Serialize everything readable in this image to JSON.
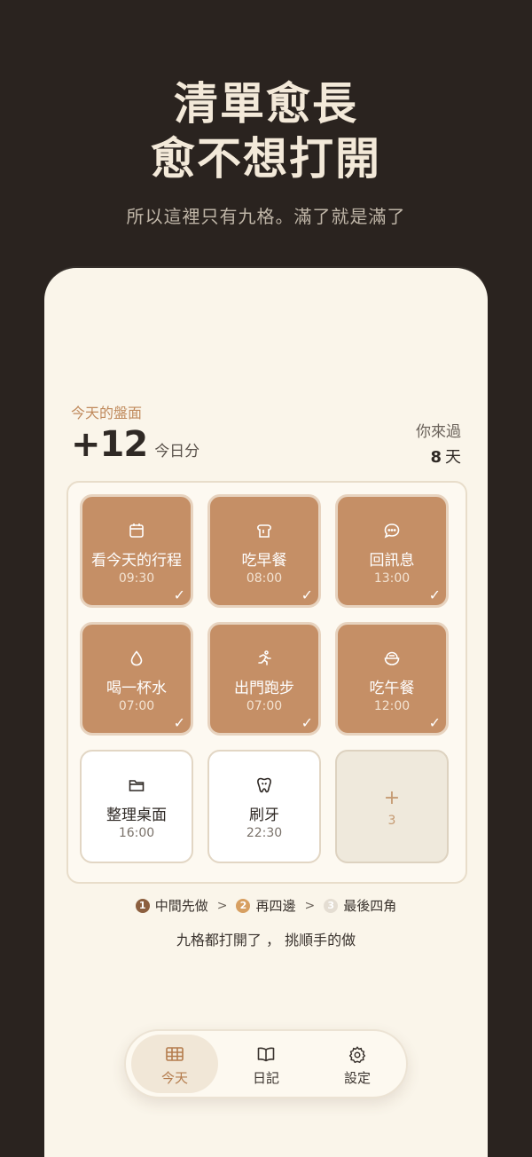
{
  "hero": {
    "title_line1": "清單愈長",
    "title_line2": "愈不想打開",
    "subtitle": "所以這裡只有九格。滿了就是滿了"
  },
  "board": {
    "label": "今天的盤面",
    "score": "+12",
    "score_unit": "今日分",
    "visited_label": "你來過",
    "visited_days": "8",
    "visited_unit": "天"
  },
  "tiles": [
    {
      "name": "看今天的行程",
      "time": "09:30",
      "icon": "calendar-icon",
      "done": true
    },
    {
      "name": "吃早餐",
      "time": "08:00",
      "icon": "toast-icon",
      "done": true
    },
    {
      "name": "回訊息",
      "time": "13:00",
      "icon": "chat-bubble-icon",
      "done": true
    },
    {
      "name": "喝一杯水",
      "time": "07:00",
      "icon": "water-drop-icon",
      "done": true
    },
    {
      "name": "出門跑步",
      "time": "07:00",
      "icon": "runner-icon",
      "done": true
    },
    {
      "name": "吃午餐",
      "time": "12:00",
      "icon": "rice-bowl-icon",
      "done": true
    },
    {
      "name": "整理桌面",
      "time": "16:00",
      "icon": "folder-icon",
      "done": false
    },
    {
      "name": "刷牙",
      "time": "22:30",
      "icon": "tooth-icon",
      "done": false
    }
  ],
  "add_tile": {
    "plus": "+",
    "count": "3"
  },
  "steps": {
    "s1_num": "1",
    "s1_label": "中間先做",
    "s2_num": "2",
    "s2_label": "再四邊",
    "s3_num": "3",
    "s3_label": "最後四角",
    "separator": ">"
  },
  "hint": "九格都打開了 ， 挑順手的做",
  "tabs": [
    {
      "label": "今天",
      "icon": "grid-icon",
      "active": true
    },
    {
      "label": "日記",
      "icon": "book-icon",
      "active": false
    },
    {
      "label": "設定",
      "icon": "gear-icon",
      "active": false
    }
  ],
  "colors": {
    "background": "#2a231f",
    "panel": "#faf5ea",
    "tile_done": "#c58f66",
    "accent": "#c08a5c"
  }
}
